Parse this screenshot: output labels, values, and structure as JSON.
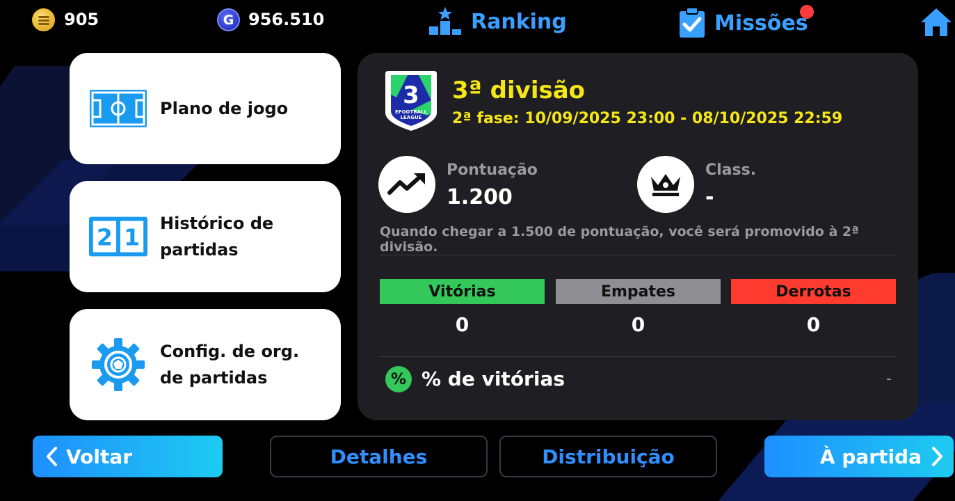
{
  "topbar": {
    "coins_icon": "efootball-coin-icon",
    "coins_value": "905",
    "gp_icon": "gp-icon",
    "gp_symbol": "G",
    "gp_value": "956.510",
    "ranking_label": "Ranking",
    "missions_label": "Missões",
    "missions_has_notification": true,
    "home_icon": "home-icon"
  },
  "menu": {
    "items": [
      {
        "label": "Plano de jogo",
        "icon": "field-formation-icon"
      },
      {
        "label": "Histórico de partidas",
        "icon": "scoreboard-icon"
      },
      {
        "label": "Config. de org. de partidas",
        "icon": "gear-icon"
      }
    ],
    "scoreboard_digits": [
      "2",
      "1"
    ]
  },
  "division": {
    "badge_text": "EFOOTBALL LEAGUE",
    "badge_number": "3",
    "title": "3ª divisão",
    "phase": "2ª fase: 10/09/2025 23:00 - 08/10/2025 22:59"
  },
  "stats": {
    "score_label": "Pontuação",
    "score_value": "1.200",
    "class_label": "Class.",
    "class_value": "-",
    "promo_note": "Quando chegar a 1.500 de pontuação, você será promovido à 2ª divisão."
  },
  "results": {
    "wins_label": "Vitórias",
    "wins_value": "0",
    "draws_label": "Empates",
    "draws_value": "0",
    "losses_label": "Derrotas",
    "losses_value": "0"
  },
  "win_rate": {
    "icon_symbol": "%",
    "label": "% de vitórias",
    "value": "-"
  },
  "buttons": {
    "back": "Voltar",
    "details": "Detalhes",
    "distribution": "Distribuição",
    "play": "À partida"
  },
  "colors": {
    "accent_blue": "#2f8fff",
    "division_yellow": "#f5e616",
    "win_green": "#34c759",
    "draw_gray": "#8e8e93",
    "loss_red": "#ff3b30"
  }
}
